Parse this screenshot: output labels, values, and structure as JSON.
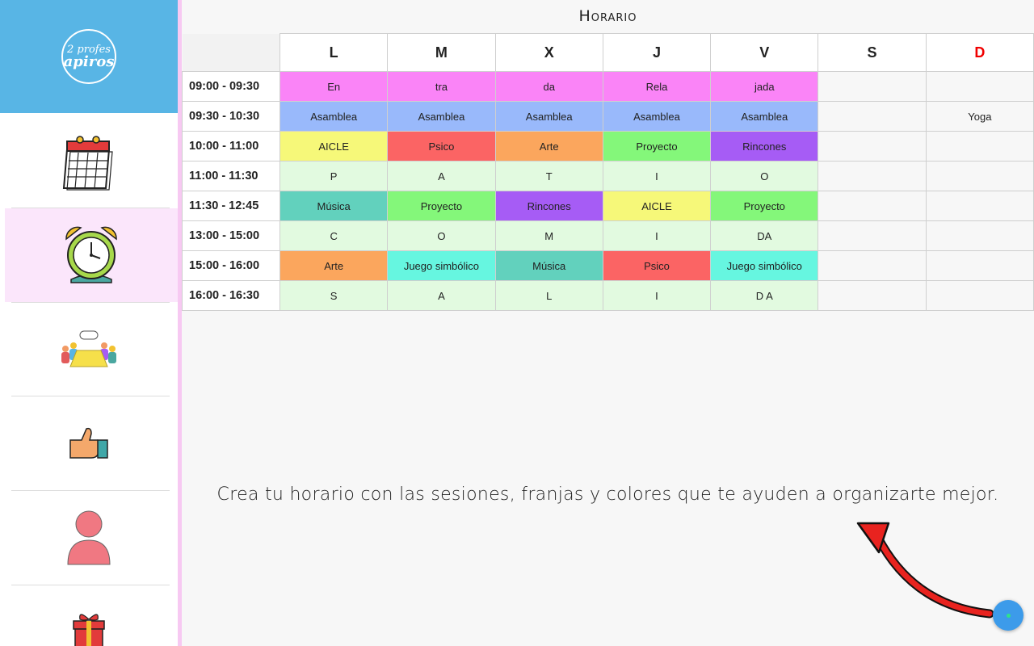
{
  "page": {
    "title": "Horario"
  },
  "logo": {
    "line1": "2 profes",
    "line2": "apiros"
  },
  "sidebar": {
    "items": [
      {
        "icon": "calendar-icon",
        "label": "Calendario"
      },
      {
        "icon": "alarm-clock-icon",
        "label": "Horario",
        "active": true
      },
      {
        "icon": "meeting-icon",
        "label": "Reuniones"
      },
      {
        "icon": "thumbs-up-icon",
        "label": "Valoraciones"
      },
      {
        "icon": "person-icon",
        "label": "Alumnos"
      },
      {
        "icon": "gift-icon",
        "label": "Regalos"
      }
    ]
  },
  "schedule": {
    "days": [
      "L",
      "M",
      "X",
      "J",
      "V",
      "S",
      "D"
    ],
    "sunday_color": "#f00000",
    "rows": [
      {
        "time": "09:00 - 09:30",
        "cells": [
          {
            "text": "En",
            "color": "#fa84f7"
          },
          {
            "text": "tra",
            "color": "#fa84f7"
          },
          {
            "text": "da",
            "color": "#fa84f7"
          },
          {
            "text": "Rela",
            "color": "#fa84f7"
          },
          {
            "text": "jada",
            "color": "#fa84f7"
          },
          {
            "text": "",
            "color": ""
          },
          {
            "text": "",
            "color": ""
          }
        ]
      },
      {
        "time": "09:30 - 10:30",
        "cells": [
          {
            "text": "Asamblea",
            "color": "#99b9fb"
          },
          {
            "text": "Asamblea",
            "color": "#99b9fb"
          },
          {
            "text": "Asamblea",
            "color": "#99b9fb"
          },
          {
            "text": "Asamblea",
            "color": "#99b9fb"
          },
          {
            "text": "Asamblea",
            "color": "#99b9fb"
          },
          {
            "text": "",
            "color": ""
          },
          {
            "text": "Yoga",
            "color": ""
          }
        ]
      },
      {
        "time": "10:00 - 11:00",
        "cells": [
          {
            "text": "AICLE",
            "color": "#f6f879"
          },
          {
            "text": "Psico",
            "color": "#fb6464"
          },
          {
            "text": "Arte",
            "color": "#fba65d"
          },
          {
            "text": "Proyecto",
            "color": "#84f77a"
          },
          {
            "text": "Rincones",
            "color": "#a65cf5"
          },
          {
            "text": "",
            "color": ""
          },
          {
            "text": "",
            "color": ""
          }
        ]
      },
      {
        "time": "11:00 - 11:30",
        "cells": [
          {
            "text": "P",
            "color": "#e2fae0"
          },
          {
            "text": "A",
            "color": "#e2fae0"
          },
          {
            "text": "T",
            "color": "#e2fae0"
          },
          {
            "text": "I",
            "color": "#e2fae0"
          },
          {
            "text": "O",
            "color": "#e2fae0"
          },
          {
            "text": "",
            "color": ""
          },
          {
            "text": "",
            "color": ""
          }
        ]
      },
      {
        "time": "11:30 - 12:45",
        "cells": [
          {
            "text": "Música",
            "color": "#62d1bd"
          },
          {
            "text": "Proyecto",
            "color": "#84f77a"
          },
          {
            "text": "Rincones",
            "color": "#a65cf5"
          },
          {
            "text": "AICLE",
            "color": "#f6f879"
          },
          {
            "text": "Proyecto",
            "color": "#84f77a"
          },
          {
            "text": "",
            "color": ""
          },
          {
            "text": "",
            "color": ""
          }
        ]
      },
      {
        "time": "13:00 - 15:00",
        "cells": [
          {
            "text": "C",
            "color": "#e2fae0"
          },
          {
            "text": "O",
            "color": "#e2fae0"
          },
          {
            "text": "M",
            "color": "#e2fae0"
          },
          {
            "text": "I",
            "color": "#e2fae0"
          },
          {
            "text": "DA",
            "color": "#e2fae0"
          },
          {
            "text": "",
            "color": ""
          },
          {
            "text": "",
            "color": ""
          }
        ]
      },
      {
        "time": "15:00 - 16:00",
        "cells": [
          {
            "text": "Arte",
            "color": "#fba65d"
          },
          {
            "text": "Juego simbólico",
            "color": "#66f6e0"
          },
          {
            "text": "Música",
            "color": "#62d1bd"
          },
          {
            "text": "Psico",
            "color": "#fb6464"
          },
          {
            "text": "Juego simbólico",
            "color": "#66f6e0"
          },
          {
            "text": "",
            "color": ""
          },
          {
            "text": "",
            "color": ""
          }
        ]
      },
      {
        "time": "16:00 - 16:30",
        "cells": [
          {
            "text": "S",
            "color": "#e2fae0"
          },
          {
            "text": "A",
            "color": "#e2fae0"
          },
          {
            "text": "L",
            "color": "#e2fae0"
          },
          {
            "text": "I",
            "color": "#e2fae0"
          },
          {
            "text": "D  A",
            "color": "#e2fae0"
          },
          {
            "text": "",
            "color": ""
          },
          {
            "text": "",
            "color": ""
          }
        ]
      }
    ]
  },
  "caption": "Crea tu horario con las sesiones, franjas y colores que te ayuden a organizarte mejor.",
  "fab": {
    "icon": "add-icon"
  }
}
